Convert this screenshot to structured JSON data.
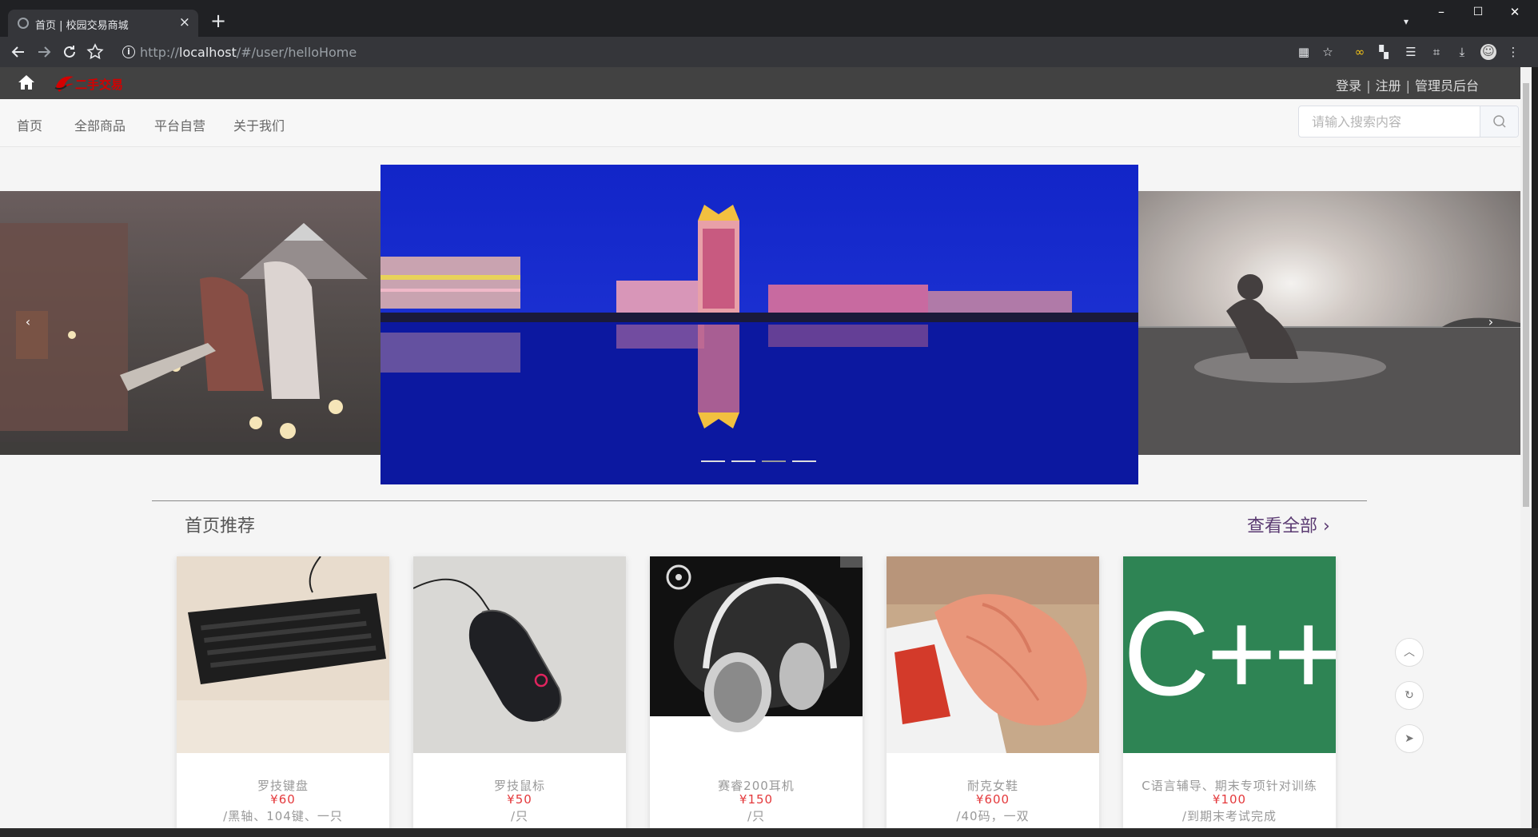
{
  "browser": {
    "tab_title": "首页 | 校园交易商城",
    "tab_close": "×",
    "new_tab": "+",
    "tab_search": "▾",
    "minimize": "–",
    "maximize": "☐",
    "close": "✕",
    "url_host": "localhost",
    "url_prefix": "http://",
    "url_path": "/#/user/helloHome"
  },
  "site": {
    "logo_text": "二手交易",
    "auth": {
      "login": "登录",
      "separator": "|",
      "register": "注册",
      "admin": "管理员后台"
    }
  },
  "nav": {
    "items": [
      "首页",
      "全部商品",
      "平台自营",
      "关于我们"
    ],
    "search_placeholder": "请输入搜索内容"
  },
  "carousel": {
    "prev": "‹",
    "next": "›",
    "dot_count": 4,
    "active_index": 2
  },
  "recommend": {
    "title": "首页推荐",
    "view_all": "查看全部",
    "view_all_arrow": "›",
    "products": [
      {
        "name": "罗技键盘",
        "price": "¥60",
        "desc": "/黑轴、104键、一只"
      },
      {
        "name": "罗技鼠标",
        "price": "¥50",
        "desc": "/只"
      },
      {
        "name": "赛睿200耳机",
        "price": "¥150",
        "desc": "/只"
      },
      {
        "name": "耐克女鞋",
        "price": "¥600",
        "desc": "/40码，一双"
      },
      {
        "name": "C语言辅导、期末专项针对训练",
        "price": "¥100",
        "desc": "/到期末考试完成"
      }
    ],
    "cpp_label": "C++"
  },
  "float_buttons": [
    "︿",
    "↻",
    "➤"
  ],
  "colors": {
    "header_bg": "#424242",
    "price": "#e4393c",
    "view_all": "#5b3b72",
    "cpp_bg": "#2e8454"
  }
}
